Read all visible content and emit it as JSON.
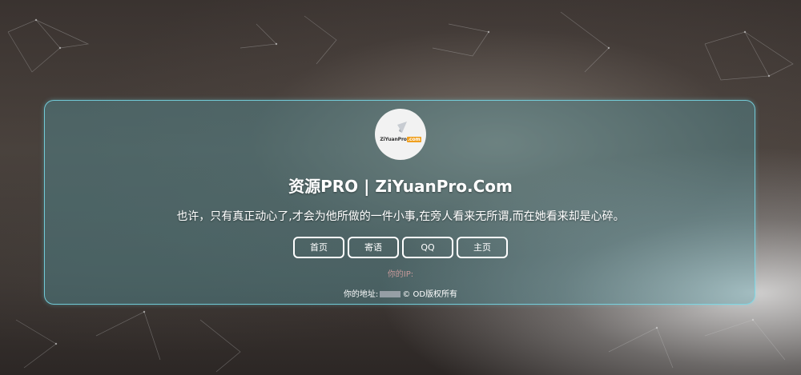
{
  "logo": {
    "brand_text": "ZiYuanPro",
    "brand_suffix": ".com"
  },
  "header": {
    "title": "资源PRO | ZiYuanPro.Com",
    "motto": "也许，只有真正动心了,才会为他所做的一件小事,在旁人看来无所谓,而在她看来却是心碎。"
  },
  "nav": {
    "items": [
      {
        "label": "首页"
      },
      {
        "label": "寄语"
      },
      {
        "label": "QQ"
      },
      {
        "label": "主页"
      }
    ]
  },
  "footer": {
    "ip_label": "你的IP:",
    "address_label": "你的地址:",
    "copyright": "© OD版权所有"
  },
  "colors": {
    "panel_border": "#78dceb",
    "ip_text": "#c79a9a",
    "button_border": "#ffffff"
  }
}
